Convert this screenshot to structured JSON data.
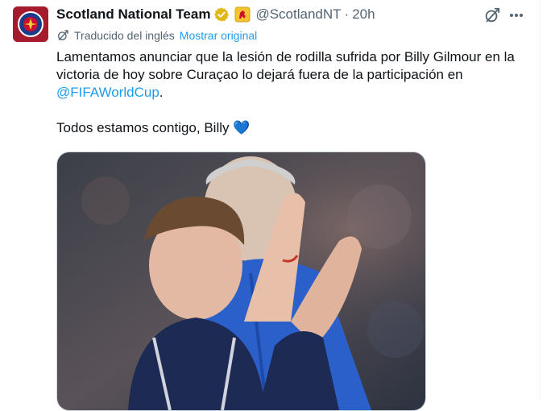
{
  "tweet": {
    "display_name": "Scotland National Team",
    "handle": "@ScotlandNT",
    "separator": "·",
    "time": "20h",
    "translation_label": "Traducido del inglés",
    "show_original_label": "Mostrar original",
    "text_line1": "Lamentamos anunciar que la lesión de rodilla sufrida por Billy Gilmour en la victoria de hoy sobre Curaçao lo dejará fuera de la participación en ",
    "hashtag_mention": "@FIFAWorldCup",
    "text_after_mention": ".",
    "text_line2": "Todos estamos contigo, Billy ",
    "heart_emoji": "💙"
  },
  "colors": {
    "accent": "#1d9bf0",
    "secondary_text": "#536471",
    "primary_text": "#0f1419",
    "verified_badge": "#e2b719"
  },
  "icons": {
    "avatar": "scotland-crest-icon",
    "verified": "gold-verified-badge-icon",
    "affiliate": "lion-rampant-affiliate-icon",
    "grok": "grok-icon",
    "more": "more-options-icon",
    "translate": "translate-icon"
  }
}
